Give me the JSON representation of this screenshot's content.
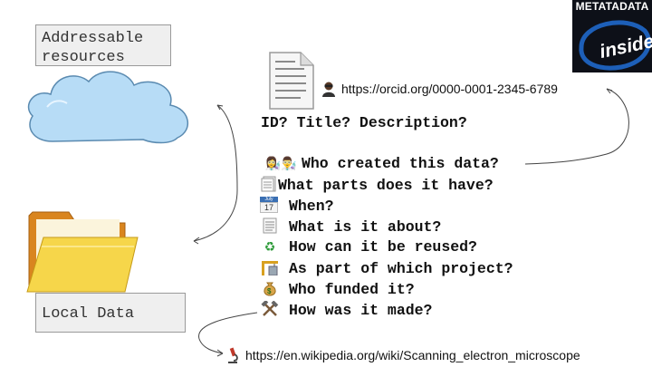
{
  "addressable_label": "Addressable\nresources",
  "local_label": "Local Data",
  "orcid_url": "https://orcid.org/0000-0001-2345-6789",
  "main_question": "ID? Title? Description?",
  "questions": [
    "Who created this data?",
    "What parts does it have?",
    "When?",
    "What is it about?",
    "How can it be reused?",
    "As part of which project?",
    "Who funded it?",
    "How was it made?"
  ],
  "calendar_month": "July",
  "calendar_day": "17",
  "wiki_url": "https://en.wikipedia.org/wiki/Scanning_electron_microscope",
  "badge": {
    "title": "METATADATA",
    "inside": "inside"
  },
  "icons": {
    "cloud": "cloud-icon",
    "folder": "folder-icon",
    "document": "document-icon",
    "people": "people-icon",
    "parts": "page-stack-icon",
    "calendar": "calendar-icon",
    "topic": "notepad-icon",
    "reuse": "recycle-icon",
    "project": "construction-icon",
    "funding": "money-bag-icon",
    "method": "tools-icon",
    "microscope": "microscope-icon"
  },
  "colors": {
    "cloud_fill": "#b7dcf6",
    "cloud_stroke": "#5a8ab0",
    "folder_front": "#f6d64a",
    "folder_back": "#d9851f",
    "badge_bg": "#0d1018",
    "badge_ring": "#1d5fb8"
  }
}
